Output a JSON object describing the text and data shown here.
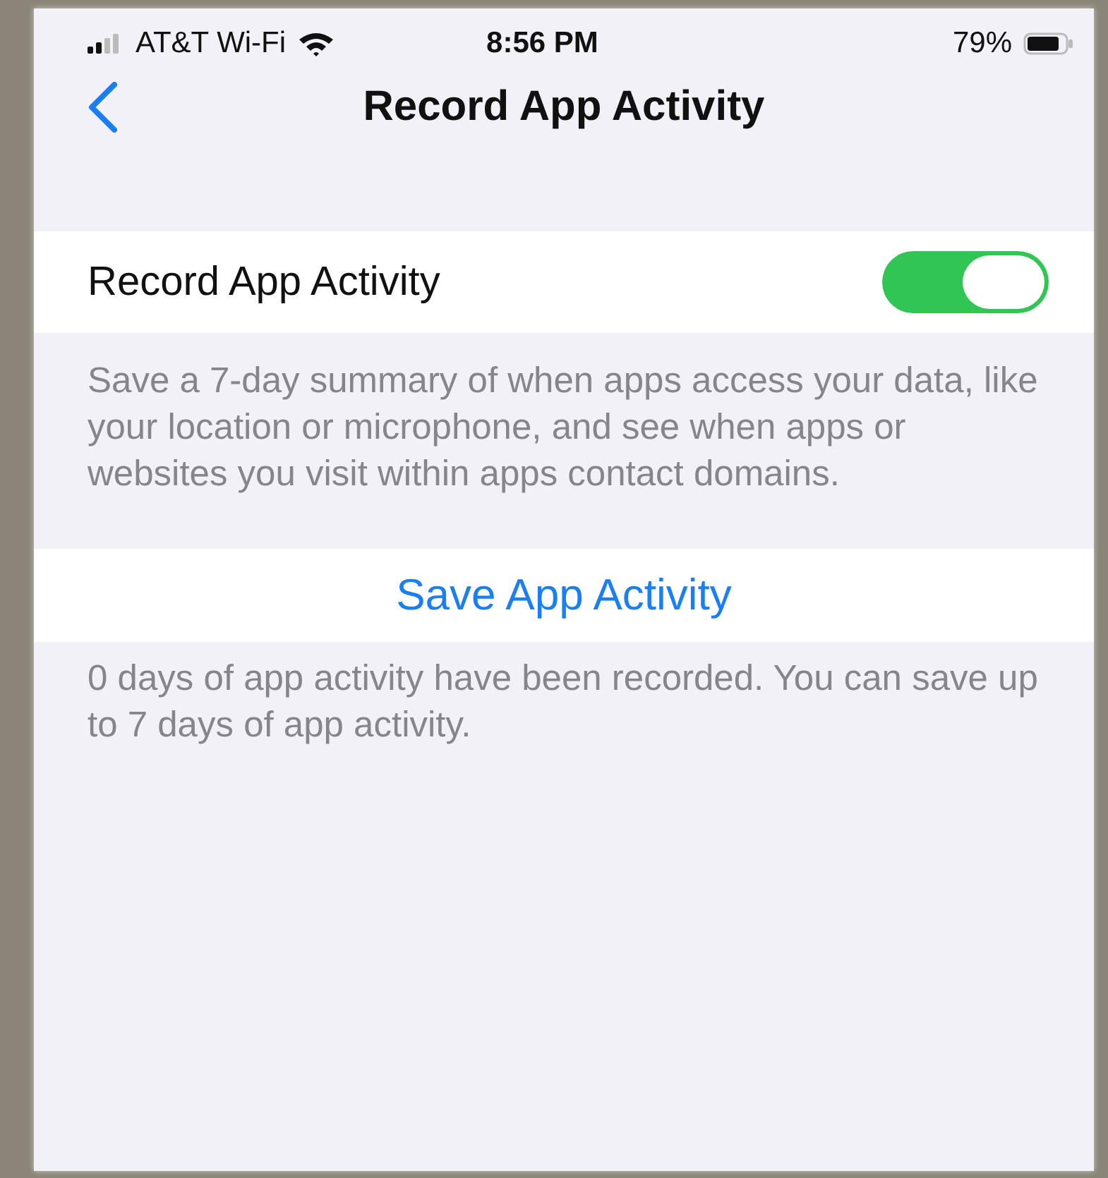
{
  "status_bar": {
    "carrier": "AT&T Wi-Fi",
    "time": "8:56 PM",
    "battery": "79%"
  },
  "nav": {
    "title": "Record App Activity"
  },
  "toggle_row": {
    "label": "Record App Activity",
    "on": true
  },
  "description": "Save a 7-day summary of when apps access your data, like your location or microphone, and see when apps or websites you visit within apps contact domains.",
  "save_button": "Save App Activity",
  "footer": "0 days of app activity have been recorded. You can save up to 7 days of app activity."
}
